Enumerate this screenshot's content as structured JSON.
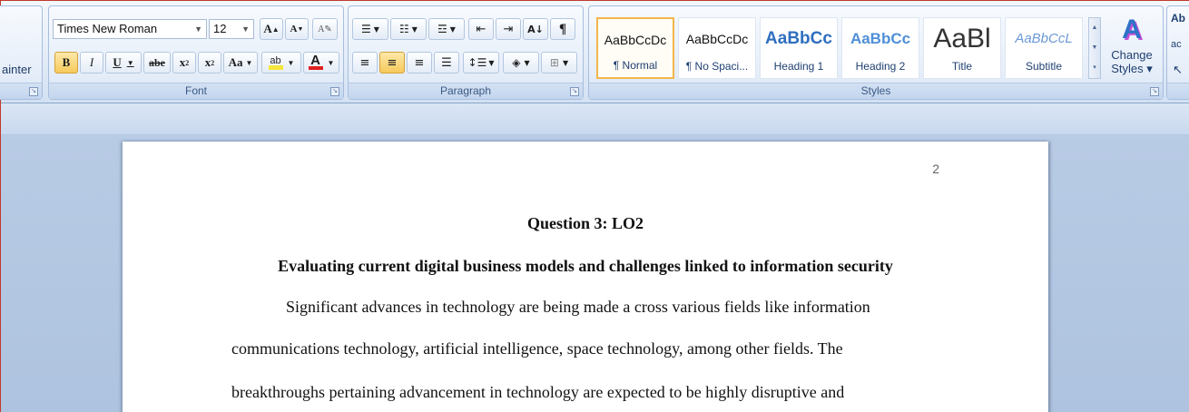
{
  "clipboard": {
    "format_painter_label": "ainter"
  },
  "font": {
    "name": "Times New Roman",
    "size": "12",
    "group_label": "Font",
    "buttons": {
      "grow": "A",
      "shrink": "A",
      "bold": "B",
      "italic": "I",
      "underline": "U",
      "strike": "abe",
      "subscript": "x",
      "superscript": "x",
      "change_case": "Aa",
      "highlight": "ab",
      "font_color": "A"
    },
    "highlight_color": "#f5e63a",
    "font_color": "#e02020"
  },
  "paragraph": {
    "group_label": "Paragraph",
    "pilcrow": "¶"
  },
  "styles": {
    "group_label": "Styles",
    "items": [
      {
        "sample": "AaBbCcDc",
        "name": "¶ Normal"
      },
      {
        "sample": "AaBbCcDc",
        "name": "¶ No Spaci..."
      },
      {
        "sample": "AaBbCc",
        "name": "Heading 1"
      },
      {
        "sample": "AaBbCc",
        "name": "Heading 2"
      },
      {
        "sample": "AaBl",
        "name": "Title"
      },
      {
        "sample": "AaBbCcL",
        "name": "Subtitle"
      }
    ],
    "change_styles_line1": "Change",
    "change_styles_line2": "Styles ▾"
  },
  "document": {
    "page_number": "2",
    "heading1": "Question 3: LO2",
    "heading2": "Evaluating current digital business models and challenges linked to information security",
    "lines": [
      "Significant advances in technology are being made a cross various fields like information",
      "communications technology, artificial intelligence, space technology, among other fields. The",
      "breakthroughs pertaining advancement in technology are expected to be highly disruptive and"
    ]
  },
  "colors": {
    "accent": "#2b579a",
    "selected_style": "#f2b64c",
    "active_button": "#f6c95b"
  }
}
